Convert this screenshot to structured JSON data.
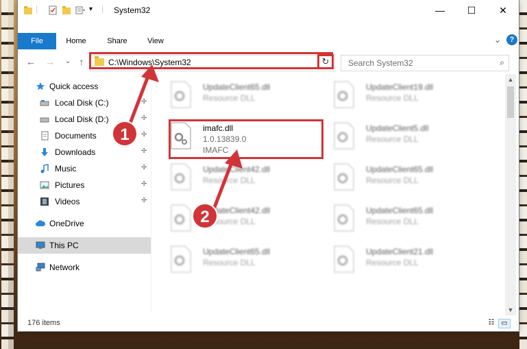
{
  "window": {
    "title": "System32",
    "controls": {
      "minimize": "—",
      "maximize": "☐",
      "close": "✕"
    }
  },
  "ribbon": {
    "tabs": [
      {
        "label": "File",
        "active": true
      },
      {
        "label": "Home",
        "active": false
      },
      {
        "label": "Share",
        "active": false
      },
      {
        "label": "View",
        "active": false
      }
    ],
    "expand_glyph": "⌄",
    "help_glyph": "?"
  },
  "nav": {
    "back": "←",
    "forward": "→",
    "recent": "⌄",
    "up": "↑",
    "address": "C:\\Windows\\System32",
    "address_dropdown": "⌄",
    "refresh": "↻",
    "search_placeholder": "Search System32",
    "search_icon": "⌕"
  },
  "sidebar": {
    "items": [
      {
        "label": "Quick access",
        "icon": "star-icon",
        "pinned": false
      },
      {
        "label": "Local Disk (C:)",
        "icon": "drive-icon",
        "pinned": true
      },
      {
        "label": "Local Disk (D:)",
        "icon": "drive-icon",
        "pinned": true
      },
      {
        "label": "Documents",
        "icon": "documents-icon",
        "pinned": true
      },
      {
        "label": "Downloads",
        "icon": "download-icon",
        "pinned": true
      },
      {
        "label": "Music",
        "icon": "music-icon",
        "pinned": true
      },
      {
        "label": "Pictures",
        "icon": "pictures-icon",
        "pinned": true
      },
      {
        "label": "Videos",
        "icon": "videos-icon",
        "pinned": true
      },
      {
        "label": "OneDrive",
        "icon": "cloud-icon",
        "pinned": false
      },
      {
        "label": "This PC",
        "icon": "computer-icon",
        "pinned": false,
        "selected": true
      },
      {
        "label": "Network",
        "icon": "network-icon",
        "pinned": false
      }
    ],
    "pin_glyph": "📌"
  },
  "files": [
    {
      "name": "UpdateClient65.dll",
      "type": "Resource DLL",
      "blurred": true
    },
    {
      "name": "UpdateClient19.dll",
      "type": "Resource DLL",
      "blurred": true
    },
    {
      "name": "imafc.dll",
      "type": "1.0.13839.0",
      "desc": "IMAFC",
      "blurred": false
    },
    {
      "name": "UpdateClient5.dll",
      "type": "Resource DLL",
      "blurred": true
    },
    {
      "name": "UpdateClient42.dll",
      "type": "Resource DLL",
      "blurred": true
    },
    {
      "name": "UpdateClient65.dll",
      "type": "Resource DLL",
      "blurred": true
    },
    {
      "name": "UpdateClient42.dll",
      "type": "Resource DLL",
      "blurred": true
    },
    {
      "name": "UpdateClient65.dll",
      "type": "Resource DLL",
      "blurred": true
    },
    {
      "name": "UpdateClient65.dll",
      "type": "Resource DLL",
      "blurred": true
    },
    {
      "name": "UpdateClient21.dll",
      "type": "Resource DLL",
      "blurred": true
    }
  ],
  "status": {
    "item_count": "176 items"
  },
  "annotations": {
    "badge_1": "1",
    "badge_2": "2",
    "color": "#d13438"
  }
}
